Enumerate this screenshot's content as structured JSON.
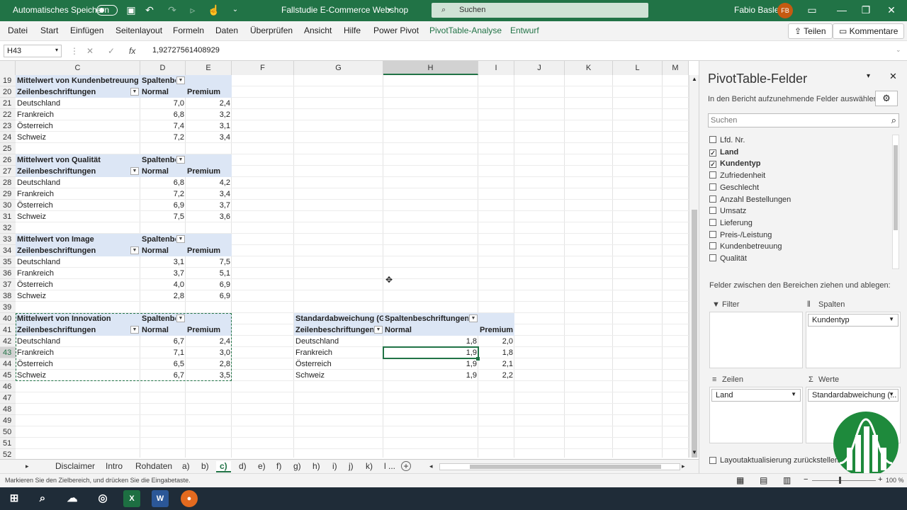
{
  "titlebar": {
    "autosave_label": "Automatisches Speichern",
    "doc_title": "Fallstudie E-Commerce Webshop",
    "search_placeholder": "Suchen",
    "user_name": "Fabio Basler",
    "user_initials": "FB"
  },
  "menu": {
    "items": [
      "Datei",
      "Start",
      "Einfügen",
      "Seitenlayout",
      "Formeln",
      "Daten",
      "Überprüfen",
      "Ansicht",
      "Hilfe",
      "Power Pivot",
      "PivotTable-Analyse",
      "Entwurf"
    ],
    "share_label": "Teilen",
    "comments_label": "Kommentare"
  },
  "formula_bar": {
    "name_box": "H43",
    "fx_label": "fx",
    "value": "1,92727561408929"
  },
  "columns": [
    "C",
    "D",
    "E",
    "F",
    "G",
    "H",
    "I",
    "J",
    "K",
    "L",
    "M"
  ],
  "rows": [
    "19",
    "20",
    "21",
    "22",
    "23",
    "24",
    "25",
    "26",
    "27",
    "28",
    "29",
    "30",
    "31",
    "32",
    "33",
    "34",
    "35",
    "36",
    "37",
    "38",
    "39",
    "40",
    "41",
    "42",
    "43",
    "44",
    "45",
    "46",
    "47",
    "48",
    "49",
    "50",
    "51",
    "52"
  ],
  "pivots": [
    {
      "title": "Mittelwert von Kundenbetreuung",
      "col_label": "Spaltenbe",
      "row_label": "Zeilenbeschriftungen",
      "h1": "Normal",
      "h2": "Premium",
      "rows": [
        [
          "Deutschland",
          "7,0",
          "2,4"
        ],
        [
          "Frankreich",
          "6,8",
          "3,2"
        ],
        [
          "Österreich",
          "7,4",
          "3,1"
        ],
        [
          "Schweiz",
          "7,2",
          "3,4"
        ]
      ]
    },
    {
      "title": "Mittelwert von Qualität",
      "col_label": "Spaltenbe",
      "row_label": "Zeilenbeschriftungen",
      "h1": "Normal",
      "h2": "Premium",
      "rows": [
        [
          "Deutschland",
          "6,8",
          "4,2"
        ],
        [
          "Frankreich",
          "7,2",
          "3,4"
        ],
        [
          "Österreich",
          "6,9",
          "3,7"
        ],
        [
          "Schweiz",
          "7,5",
          "3,6"
        ]
      ]
    },
    {
      "title": "Mittelwert von Image",
      "col_label": "Spaltenbe",
      "row_label": "Zeilenbeschriftungen",
      "h1": "Normal",
      "h2": "Premium",
      "rows": [
        [
          "Deutschland",
          "3,1",
          "7,5"
        ],
        [
          "Frankreich",
          "3,7",
          "5,1"
        ],
        [
          "Österreich",
          "4,0",
          "6,9"
        ],
        [
          "Schweiz",
          "2,8",
          "6,9"
        ]
      ]
    },
    {
      "title": "Mittelwert von Innovation",
      "col_label": "Spaltenbe",
      "row_label": "Zeilenbeschriftungen",
      "h1": "Normal",
      "h2": "Premium",
      "rows": [
        [
          "Deutschland",
          "6,7",
          "2,4"
        ],
        [
          "Frankreich",
          "7,1",
          "3,0"
        ],
        [
          "Österreich",
          "6,5",
          "2,8"
        ],
        [
          "Schweiz",
          "6,7",
          "3,5"
        ]
      ]
    }
  ],
  "std_pivot": {
    "title": "Standardabweichung (Gr",
    "col_label": "Spaltenbeschriftungen",
    "row_label": "Zeilenbeschriftungen",
    "h1": "Normal",
    "h2": "Premium",
    "rows": [
      [
        "Deutschland",
        "1,8",
        "2,0"
      ],
      [
        "Frankreich",
        "1,9",
        "1,8"
      ],
      [
        "Österreich",
        "1,9",
        "2,1"
      ],
      [
        "Schweiz",
        "1,9",
        "2,2"
      ]
    ]
  },
  "sheet_tabs": [
    "Disclaimer",
    "Intro",
    "Rohdaten",
    "a)",
    "b)",
    "c)",
    "d)",
    "e)",
    "f)",
    "g)",
    "h)",
    "i)",
    "j)",
    "k)",
    "l ..."
  ],
  "active_tab": "c)",
  "status": {
    "message": "Markieren Sie den Zielbereich, und drücken Sie die Eingabetaste.",
    "zoom": "100 %"
  },
  "pane": {
    "title": "PivotTable-Felder",
    "subtitle": "In den Bericht aufzunehmende Felder auswählen:",
    "search_placeholder": "Suchen",
    "fields": [
      {
        "label": "Lfd. Nr.",
        "checked": false
      },
      {
        "label": "Land",
        "checked": true
      },
      {
        "label": "Kundentyp",
        "checked": true
      },
      {
        "label": "Zufriedenheit",
        "checked": false
      },
      {
        "label": "Geschlecht",
        "checked": false
      },
      {
        "label": "Anzahl Bestellungen",
        "checked": false
      },
      {
        "label": "Umsatz",
        "checked": false
      },
      {
        "label": "Lieferung",
        "checked": false
      },
      {
        "label": "Preis-/Leistung",
        "checked": false
      },
      {
        "label": "Kundenbetreuung",
        "checked": false
      },
      {
        "label": "Qualität",
        "checked": false
      }
    ],
    "drag_hint": "Felder zwischen den Bereichen ziehen und ablegen:",
    "filter_label": "Filter",
    "columns_label": "Spalten",
    "columns_value": "Kundentyp",
    "rows_label": "Zeilen",
    "rows_value": "Land",
    "values_label": "Werte",
    "values_value": "Standardabweichung (...",
    "defer_label": "Layoutaktualisierung zurückstellen"
  },
  "colors": {
    "excel_green": "#217346",
    "pivot_band": "#dce6f5"
  }
}
